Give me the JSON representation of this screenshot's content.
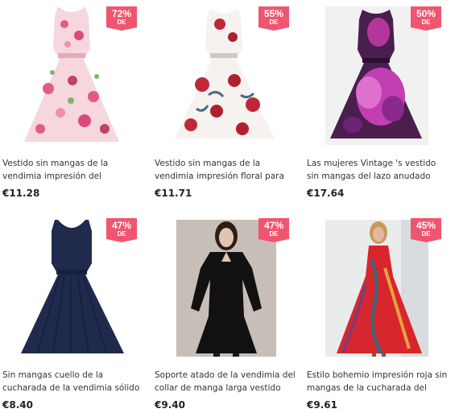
{
  "colors": {
    "badge": "#f0556f",
    "text": "#333333",
    "price": "#222222"
  },
  "products": [
    {
      "title": "Vestido sin mangas de la vendimia impresión del crisantemo para las",
      "price": "€11.28",
      "discount": "72%",
      "discount_suffix": "DE",
      "image": "pink-floral-sleeveless-dress"
    },
    {
      "title": "Vestido sin mangas de la vendimia impresión floral para las mujeres",
      "price": "€11.71",
      "discount": "55%",
      "discount_suffix": "DE",
      "image": "white-red-floral-dress"
    },
    {
      "title": "Las mujeres Vintage 's vestido sin mangas del lazo anudado",
      "price": "€17.64",
      "discount": "50%",
      "discount_suffix": "DE",
      "image": "purple-print-dress"
    },
    {
      "title": "Sin mangas cuello de la cucharada de la vendimia sólido Vestido a",
      "price": "€8.40",
      "discount": "47%",
      "discount_suffix": "DE",
      "image": "navy-aline-dress"
    },
    {
      "title": "Soporte atado de la vendimia del collar de manga larga vestido",
      "price": "€9.40",
      "discount": "47%",
      "discount_suffix": "DE",
      "image": "black-sheer-sleeve-dress"
    },
    {
      "title": "Estilo bohemio impresión roja sin mangas de la cucharada del vestido",
      "price": "€9.61",
      "discount": "45%",
      "discount_suffix": "DE",
      "image": "red-boho-maxi-dress"
    }
  ]
}
